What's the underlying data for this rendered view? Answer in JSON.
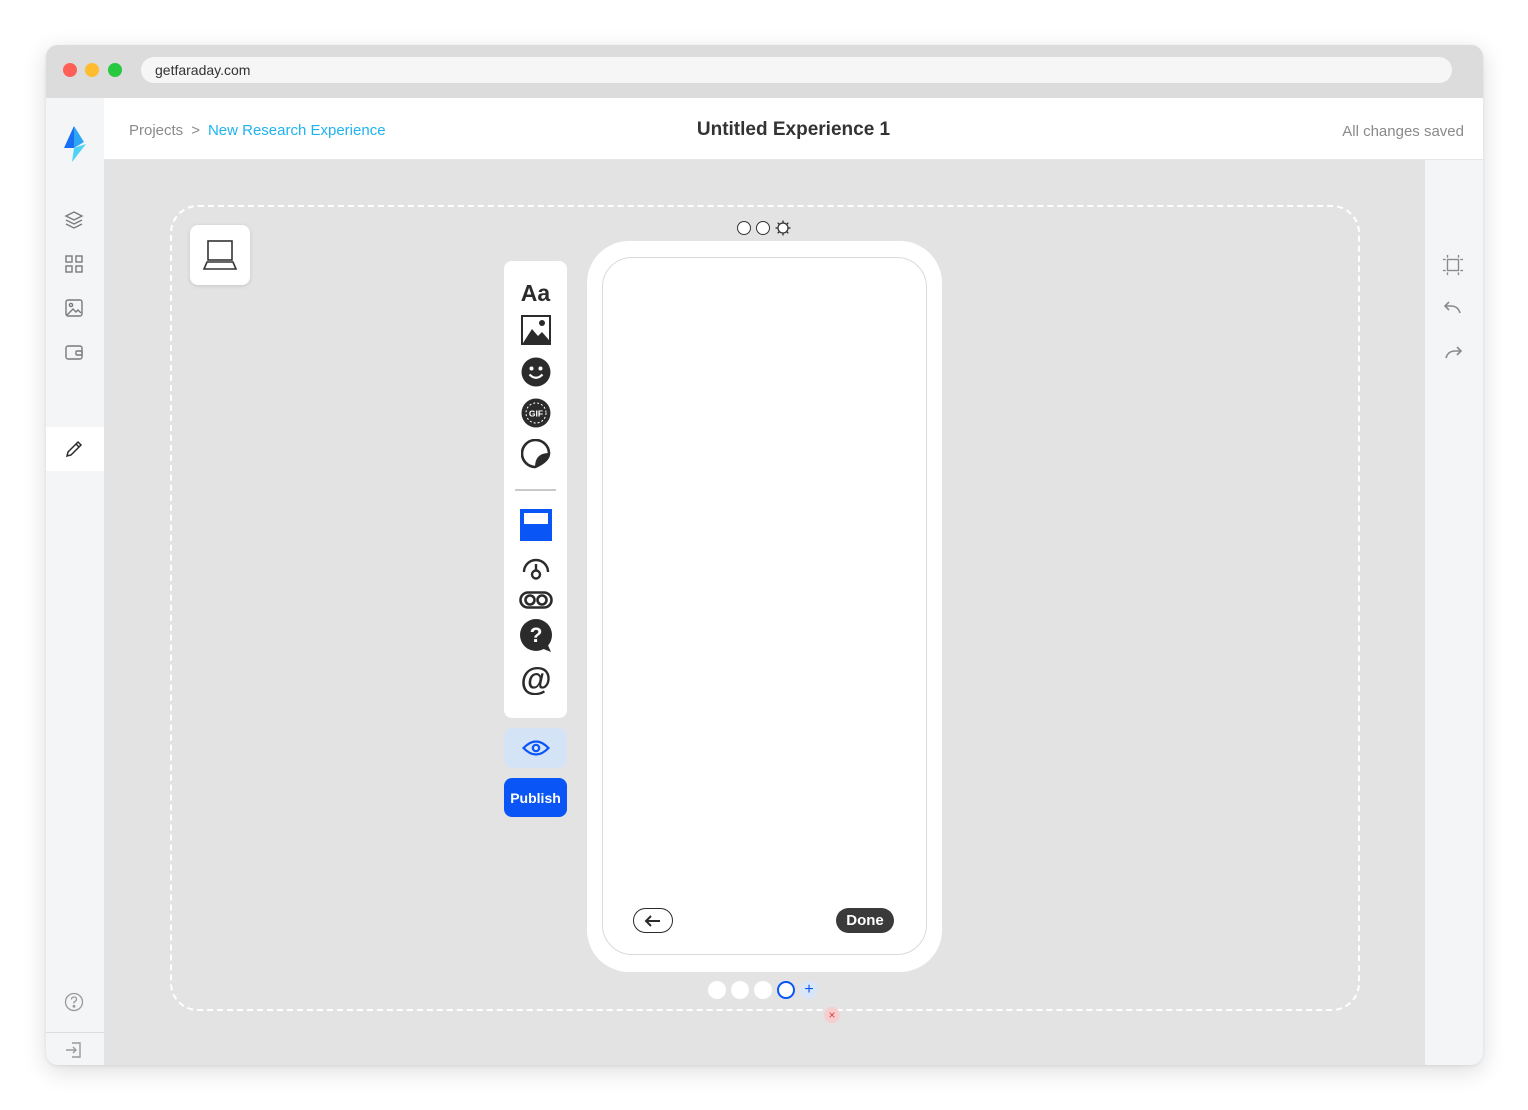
{
  "browser": {
    "url": "getfaraday.com"
  },
  "breadcrumb": {
    "root": "Projects",
    "separator": ">",
    "current": "New Research Experience"
  },
  "header": {
    "title": "Untitled Experience 1",
    "save_status": "All changes saved"
  },
  "left_rail": {
    "items": [
      {
        "icon": "layers-icon"
      },
      {
        "icon": "grid-icon"
      },
      {
        "icon": "image-icon"
      },
      {
        "icon": "wallet-icon"
      },
      {
        "icon": "pencil-icon",
        "active": true
      }
    ],
    "bottom": [
      {
        "icon": "help-icon"
      },
      {
        "icon": "logout-icon"
      }
    ]
  },
  "right_rail": {
    "items": [
      {
        "icon": "frame-icon"
      },
      {
        "icon": "undo-icon"
      },
      {
        "icon": "redo-icon"
      }
    ]
  },
  "toolbar": {
    "text_tool_label": "Aa",
    "gif_label": "GIF",
    "tools": [
      "text",
      "image",
      "emoji",
      "gif",
      "sticker",
      "card",
      "poll",
      "toggle",
      "question",
      "mention"
    ],
    "preview_icon": "eye-icon",
    "publish_label": "Publish"
  },
  "phone": {
    "back_icon": "arrow-left-icon",
    "done_label": "Done"
  },
  "pages": {
    "count": 4,
    "active_index": 3,
    "add_label": "+",
    "delete_label": "×"
  },
  "colors": {
    "accent": "#0a55f5",
    "breadcrumb_link": "#1fb3ef",
    "canvas_bg": "#e3e3e3"
  }
}
